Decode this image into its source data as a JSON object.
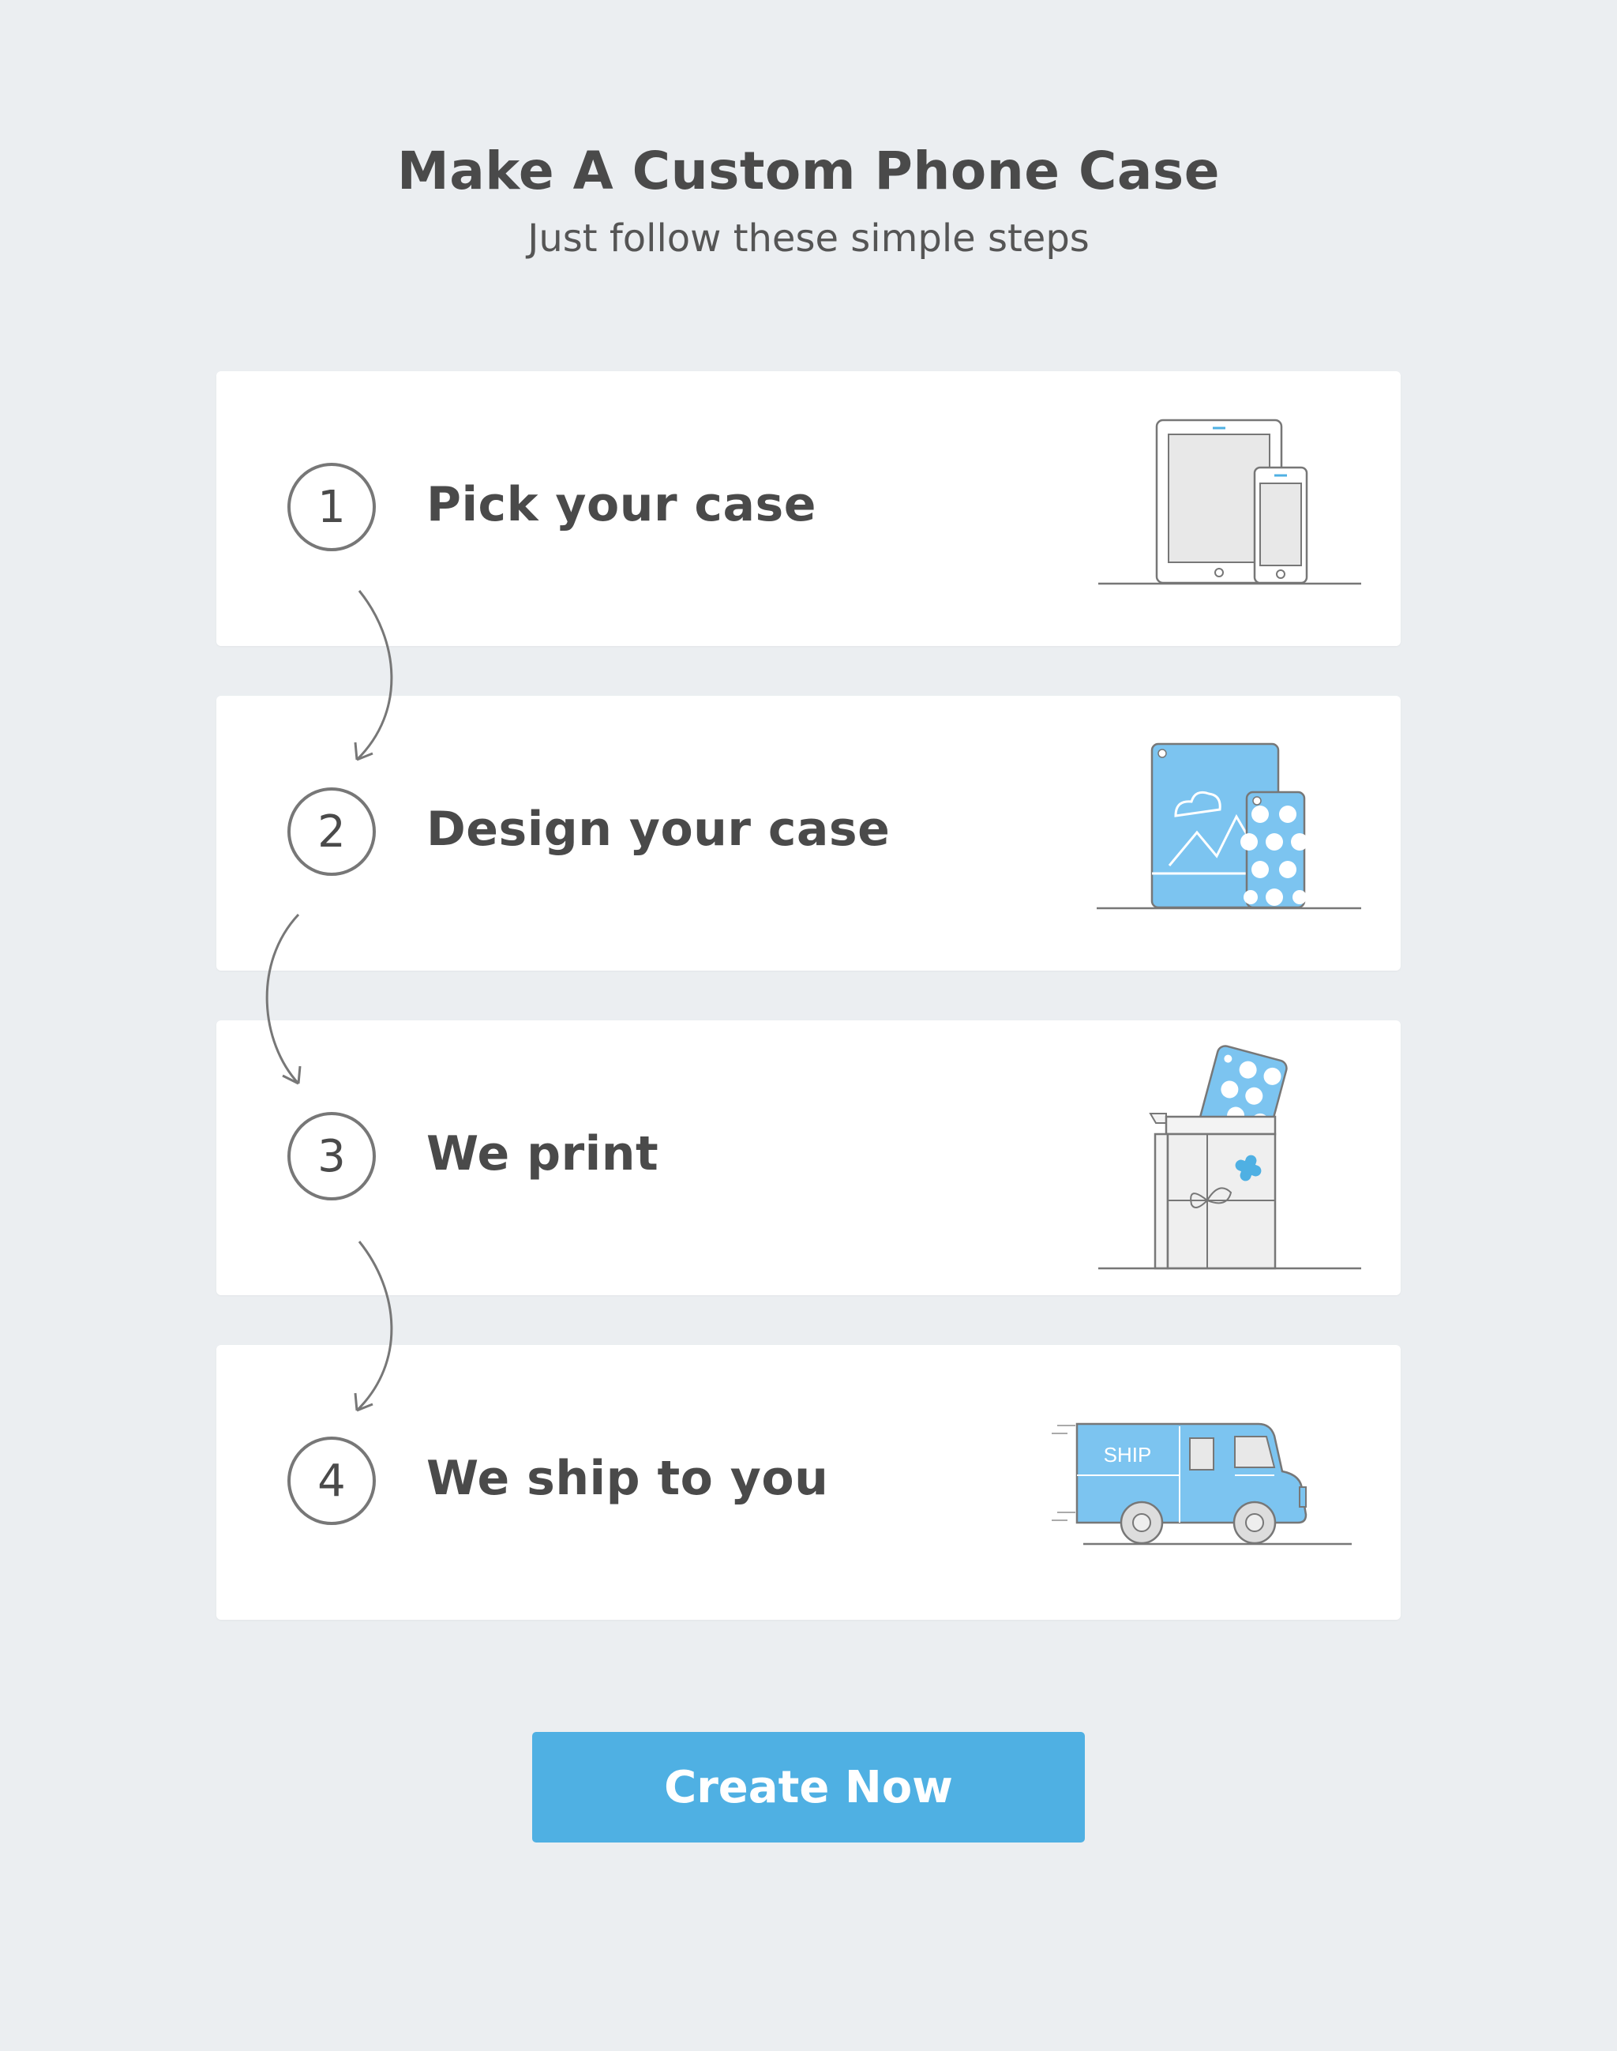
{
  "header": {
    "title": "Make A Custom Phone Case",
    "subtitle": "Just follow these simple steps"
  },
  "steps": [
    {
      "number": "1",
      "label": "Pick your case",
      "icon": "tablet-phone-icon"
    },
    {
      "number": "2",
      "label": "Design your case",
      "icon": "designed-cases-icon"
    },
    {
      "number": "3",
      "label": "We print",
      "icon": "package-box-icon"
    },
    {
      "number": "4",
      "label": "We ship to you",
      "icon": "delivery-truck-icon"
    }
  ],
  "truck_text": "SHIP",
  "cta": {
    "label": "Create Now"
  },
  "colors": {
    "background": "#ebeef1",
    "card": "#ffffff",
    "accent": "#4fb0e3",
    "illustration_blue": "#7cc4f0",
    "text": "#4a4a4a"
  }
}
